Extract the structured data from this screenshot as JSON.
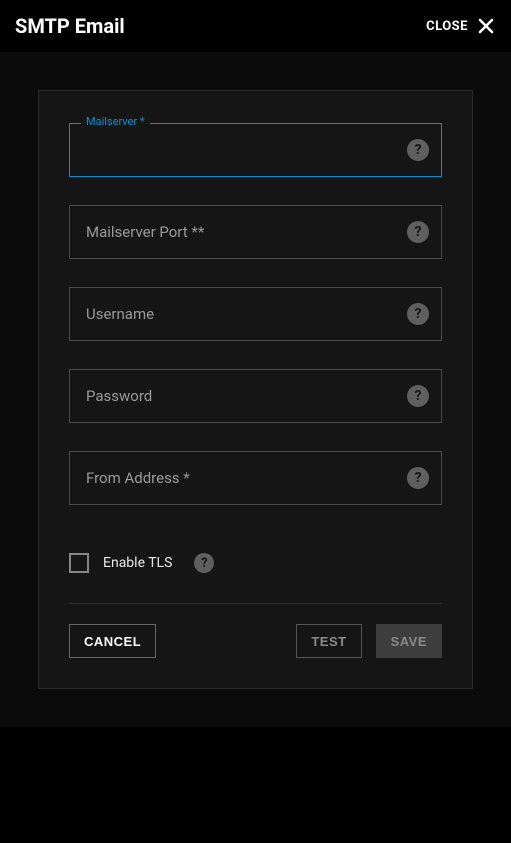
{
  "header": {
    "title": "SMTP Email",
    "close_label": "CLOSE"
  },
  "fields": {
    "mailserver": {
      "label": "Mailserver *",
      "value": ""
    },
    "port": {
      "label": "Mailserver Port **",
      "value": ""
    },
    "username": {
      "label": "Username",
      "value": ""
    },
    "password": {
      "label": "Password",
      "value": ""
    },
    "from": {
      "label": "From Address *",
      "value": ""
    }
  },
  "checkbox": {
    "label": "Enable TLS",
    "checked": false
  },
  "buttons": {
    "cancel": "CANCEL",
    "test": "TEST",
    "save": "SAVE"
  }
}
